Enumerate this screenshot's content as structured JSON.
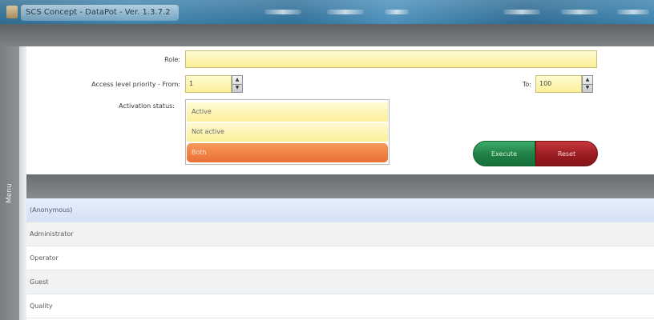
{
  "window": {
    "title": "SCS Concept - DataPot - Ver. 1.3.7.2"
  },
  "side_menu": {
    "label": "Menu"
  },
  "filter": {
    "role_label": "Role:",
    "role_value": "",
    "access_from_label": "Access level priority - From:",
    "access_from_value": "1",
    "access_to_label": "To:",
    "access_to_value": "100",
    "activation_label": "Activation status:",
    "activation_options": [
      "Active",
      "Not active",
      "Both"
    ],
    "activation_selected": "Both"
  },
  "buttons": {
    "execute_label": "Execute",
    "reset_label": "Reset"
  },
  "results": {
    "rows": [
      "(Anonymous)",
      "Administrator",
      "Operator",
      "Guest",
      "Quality"
    ],
    "selected_row": "(Anonymous)"
  },
  "colors": {
    "field_yellow": "#fbef98",
    "selected_orange": "#ea6f34",
    "execute_green": "#1f7f45",
    "reset_red": "#9a1d22",
    "selected_row_blue": "#d5e2f5"
  }
}
